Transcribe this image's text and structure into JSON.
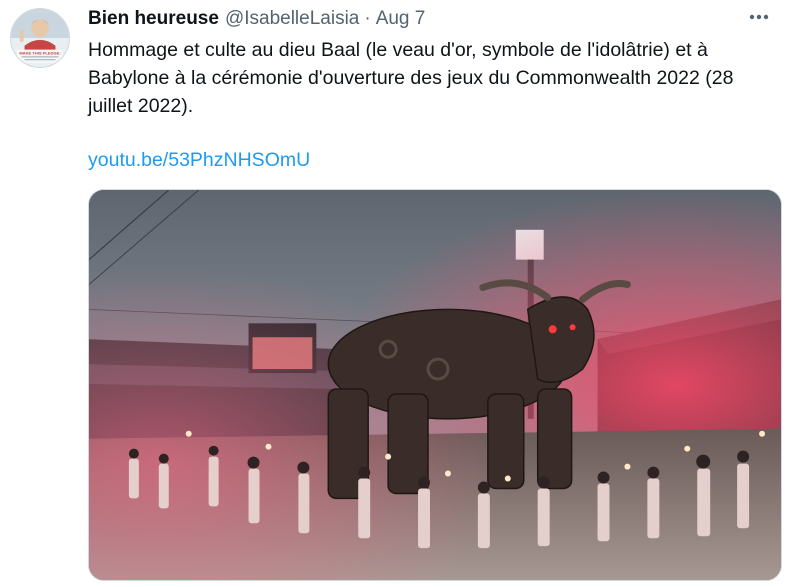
{
  "tweet": {
    "author_name": "Bien heureuse",
    "author_handle": "@IsabelleLaisia",
    "separator": "·",
    "date": "Aug 7",
    "text": "Hommage et culte au dieu Baal (le veau d'or, symbole de l'idolâtrie) et à Babylone à la cérémonie d'ouverture des jeux du Commonwealth 2022 (28 juillet 2022).",
    "link_text": "youtu.be/53PhzNHSOmU",
    "more_icon": "more-horizontal-icon",
    "avatar_caption": "MAKE THIS PLEDGE:"
  },
  "colors": {
    "text_primary": "#0f1419",
    "text_secondary": "#536471",
    "link": "#1d9bf0",
    "border": "#cfd9de"
  }
}
